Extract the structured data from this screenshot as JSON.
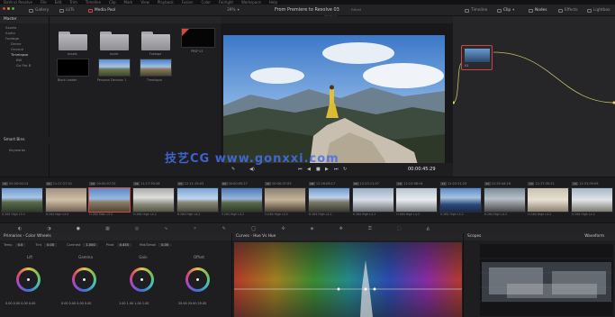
{
  "menubar": [
    "DaVinci Resolve",
    "File",
    "Edit",
    "Trim",
    "Timeline",
    "Clip",
    "Mark",
    "View",
    "Playback",
    "Fusion",
    "Color",
    "Fairlight",
    "Workspace",
    "Help"
  ],
  "topbar": {
    "gallery": "Gallery",
    "luts": "LUTs",
    "media_pool": "Media Pool",
    "zoom": "39%",
    "project_title": "From Premiere to Resolve 03",
    "edited": "Edited",
    "timeline_name": "PRSP 01",
    "timecode": "00:00:45:29",
    "timeline": "Timeline",
    "clip": "Clip",
    "nodes": "Nodes",
    "effects": "Effects",
    "lightbox": "Lightbox"
  },
  "media_pool": {
    "tree_header": "Master",
    "tree": [
      "Assets",
      "Audio",
      "Footage",
      "Drone",
      "Ground",
      "Timelapse",
      "BW",
      "Go Pro B"
    ],
    "smart_bins_header": "Smart Bins",
    "smart_bins": [
      "Keywords"
    ],
    "items": [
      {
        "label": "Assets"
      },
      {
        "label": "Audio"
      },
      {
        "label": "Footage"
      },
      {
        "label": "PRSP 01"
      },
      {
        "label": "Black Leader"
      },
      {
        "label": "Personal Decision 1"
      },
      {
        "label": "Timelapse"
      }
    ]
  },
  "viewer": {
    "timecode": "00:00:45:29"
  },
  "timeline_clips": [
    {
      "num": "01",
      "tc": "00:00:00:14",
      "caption": "H.264 High L5.0"
    },
    {
      "num": "02",
      "tc": "11:17:27:01",
      "caption": "H.264 High L5.0"
    },
    {
      "num": "03",
      "tc": "00:00:07:31",
      "caption": "H.264 Main L5.0"
    },
    {
      "num": "04",
      "tc": "11:17:30:26",
      "caption": "H.264 High L4.2"
    },
    {
      "num": "05",
      "tc": "12:11:19:03",
      "caption": "H.264 High L4.2"
    },
    {
      "num": "06",
      "tc": "00:00:05:27",
      "caption": "H.264 High L4.2"
    },
    {
      "num": "07",
      "tc": "00:00:07:05",
      "caption": "H.264 High L4.2"
    },
    {
      "num": "08",
      "tc": "12:26:08:17",
      "caption": "H.264 High L4.2"
    },
    {
      "num": "09",
      "tc": "12:23:11:07",
      "caption": "H.264 High L4.2"
    },
    {
      "num": "10",
      "tc": "12:23:58:04",
      "caption": "H.264 High L4.2"
    },
    {
      "num": "11",
      "tc": "12:22:31:25",
      "caption": "H.264 High L4.2"
    },
    {
      "num": "12",
      "tc": "12:25:44:16",
      "caption": "H.264 High L4.2"
    },
    {
      "num": "13",
      "tc": "12:17:30:21",
      "caption": "H.264 High L4.2"
    },
    {
      "num": "14",
      "tc": "12:31:09:09",
      "caption": "H.264 High L4.2"
    }
  ],
  "primaries": {
    "title": "Primaries - Color Wheels",
    "temp_label": "Temp",
    "temp": "0.0",
    "tint_label": "Tint",
    "tint": "0.00",
    "contrast_label": "Contrast",
    "contrast": "1.000",
    "pivot_label": "Pivot",
    "pivot": "0.435",
    "middetail_label": "Mid/Detail",
    "middetail": "0.00",
    "wheels": [
      {
        "label": "Lift",
        "vals": "0.00  0.00  0.00  0.00"
      },
      {
        "label": "Gamma",
        "vals": "0.00  0.00  0.00  0.00"
      },
      {
        "label": "Gain",
        "vals": "1.00  1.00  1.00  1.00"
      },
      {
        "label": "Offset",
        "vals": "25.00  25.00  25.00"
      }
    ]
  },
  "curves": {
    "title": "Curves - Hue Vs Hue"
  },
  "scopes": {
    "title": "Scopes",
    "mode": "Waveform"
  },
  "watermark": "技艺CG  www.gonxxi.com",
  "colors": {
    "accent_red": "#d64a3a",
    "panel": "#1e1e21",
    "header": "#252528"
  }
}
